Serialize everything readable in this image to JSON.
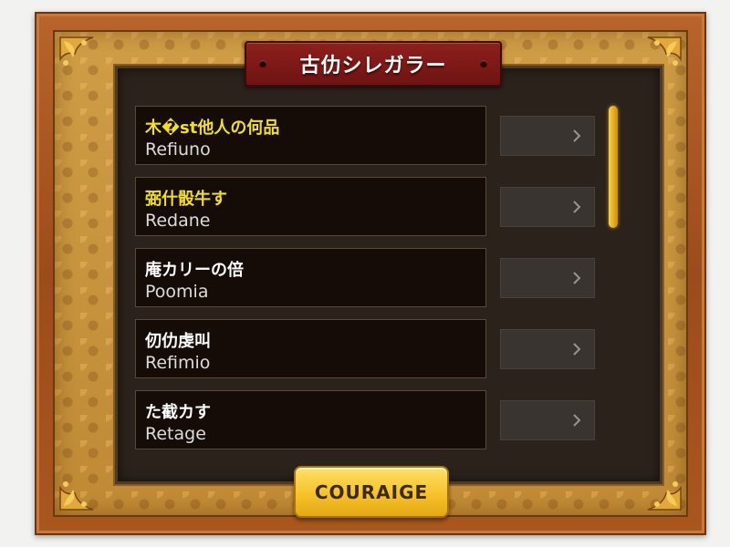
{
  "title": "古仂シレガラー",
  "rows": [
    {
      "title": "木�st他人の何品",
      "subtitle": "Refiuno",
      "highlight": true
    },
    {
      "title": "弼什骰牛す",
      "subtitle": "Redane",
      "highlight": true
    },
    {
      "title": "庵カリーの倍",
      "subtitle": "Poomia",
      "highlight": false
    },
    {
      "title": "仞仂虔叫",
      "subtitle": "Refimio",
      "highlight": false
    },
    {
      "title": "た截カす",
      "subtitle": "Retage",
      "highlight": false
    }
  ],
  "cta_label": "COURAIGE",
  "colors": {
    "frame": "#a9571f",
    "board": "#c9963f",
    "panel": "#2b221b",
    "title_plate": "#7a1816",
    "highlight_text": "#f0e020",
    "cta": "#f6c22a",
    "scrollbar": "#e4a817"
  },
  "icons": {
    "row_button": "chevron-right-icon",
    "corners": "ornament-icon"
  }
}
